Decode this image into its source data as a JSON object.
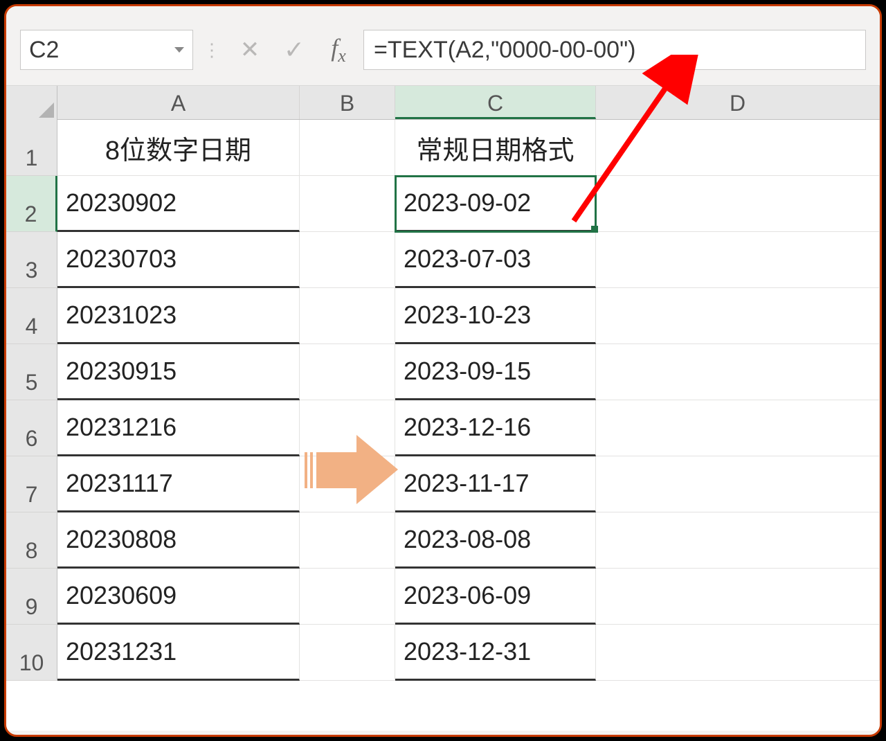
{
  "nameBox": "C2",
  "formula": "=TEXT(A2,\"0000-00-00\")",
  "colLabels": {
    "A": "A",
    "B": "B",
    "C": "C",
    "D": "D"
  },
  "rowLabels": [
    "1",
    "2",
    "3",
    "4",
    "5",
    "6",
    "7",
    "8",
    "9",
    "10"
  ],
  "headers": {
    "A": "8位数字日期",
    "C": "常规日期格式"
  },
  "data": [
    {
      "a": "20230902",
      "c": "2023-09-02"
    },
    {
      "a": "20230703",
      "c": "2023-07-03"
    },
    {
      "a": "20231023",
      "c": "2023-10-23"
    },
    {
      "a": "20230915",
      "c": "2023-09-15"
    },
    {
      "a": "20231216",
      "c": "2023-12-16"
    },
    {
      "a": "20231117",
      "c": "2023-11-17"
    },
    {
      "a": "20230808",
      "c": "2023-08-08"
    },
    {
      "a": "20230609",
      "c": "2023-06-09"
    },
    {
      "a": "20231231",
      "c": "2023-12-31"
    }
  ]
}
